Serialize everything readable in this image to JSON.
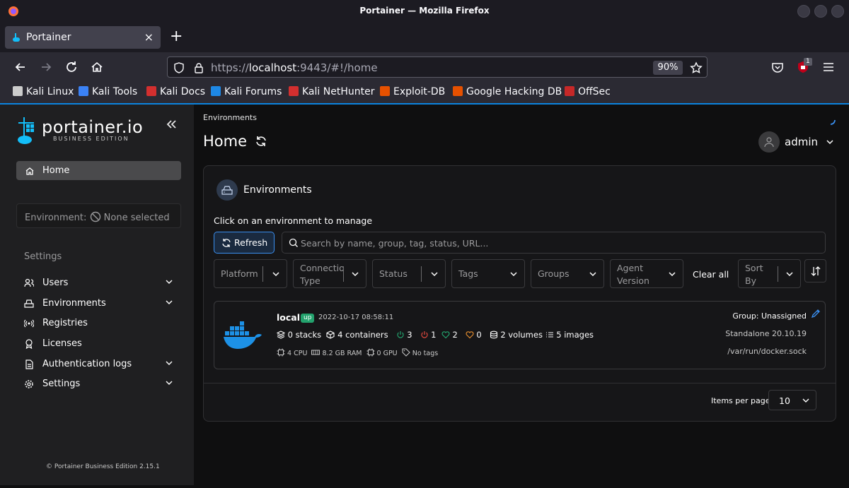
{
  "window": {
    "title": "Portainer — Mozilla Firefox"
  },
  "tabs": [
    {
      "label": "Portainer"
    }
  ],
  "navbar": {
    "url_prefix": "https://",
    "url_host": "localhost",
    "url_rest": ":9443/#!/home",
    "zoom": "90%",
    "notification_count": "1"
  },
  "bookmarks": [
    {
      "label": "Kali Linux",
      "color": "#cccccc"
    },
    {
      "label": "Kali Tools",
      "color": "#3b82f6"
    },
    {
      "label": "Kali Docs",
      "color": "#d32f2f"
    },
    {
      "label": "Kali Forums",
      "color": "#1e88e5"
    },
    {
      "label": "Kali NetHunter",
      "color": "#d32f2f"
    },
    {
      "label": "Exploit-DB",
      "color": "#e65100"
    },
    {
      "label": "Google Hacking DB",
      "color": "#e65100"
    },
    {
      "label": "OffSec",
      "color": "#c62828"
    }
  ],
  "sidebar": {
    "logo": "portainer.io",
    "logo_sub": "BUSINESS EDITION",
    "home": "Home",
    "environment_label": "Environment:",
    "environment_value": "None selected",
    "settings_header": "Settings",
    "items": [
      {
        "label": "Users",
        "icon": "users-icon",
        "expandable": true
      },
      {
        "label": "Environments",
        "icon": "server-icon",
        "expandable": true
      },
      {
        "label": "Registries",
        "icon": "broadcast-icon",
        "expandable": false
      },
      {
        "label": "Licenses",
        "icon": "award-icon",
        "expandable": false
      },
      {
        "label": "Authentication logs",
        "icon": "file-icon",
        "expandable": true
      },
      {
        "label": "Settings",
        "icon": "gear-icon",
        "expandable": true
      }
    ],
    "footer": "© Portainer Business Edition 2.15.1"
  },
  "main": {
    "breadcrumb": "Environments",
    "title": "Home",
    "user": "admin",
    "card": {
      "title": "Environments",
      "subtitle": "Click on an environment to manage",
      "refresh": "Refresh",
      "search_placeholder": "Search by name, group, tag, status, URL...",
      "filters": {
        "platform": "Platform",
        "connection_1": "Connectio",
        "connection_2": "Type",
        "status": "Status",
        "tags": "Tags",
        "groups": "Groups",
        "agent_1": "Agent",
        "agent_2": "Version",
        "clear_all": "Clear all",
        "sort_1": "Sort",
        "sort_2": "By"
      },
      "environment": {
        "name": "local",
        "status": "up",
        "time": "2022-10-17 08:58:11",
        "stacks": "0 stacks",
        "containers": "4 containers",
        "running": "3",
        "stopped": "1",
        "healthy": "2",
        "unhealthy": "0",
        "volumes": "2 volumes",
        "images": "5 images",
        "cpu": "4 CPU",
        "ram": "8.2 GB RAM",
        "gpu": "0 GPU",
        "tags": "No tags",
        "group": "Group: Unassigned",
        "type": "Standalone 20.10.19",
        "socket": "/var/run/docker.sock"
      },
      "items_per_page_label": "Items per page",
      "items_per_page": "10"
    }
  }
}
